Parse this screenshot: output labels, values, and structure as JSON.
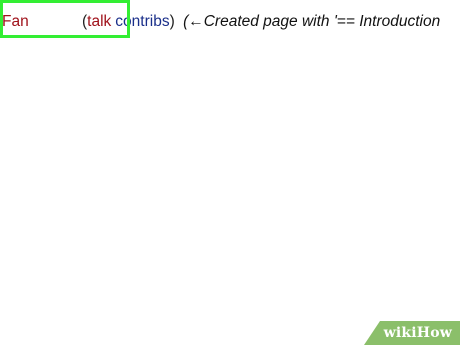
{
  "history_entry": {
    "username": "Fan",
    "open_paren": "(",
    "talk_label": "talk",
    "contribs_label": "contribs",
    "close_paren": ")",
    "summary_open": "(",
    "arrow": "←",
    "summary_text": "Created page with '== Introduction"
  },
  "colors": {
    "link_red": "#a0121b",
    "link_blue": "#1a2f8a",
    "highlight": "#33ee33",
    "watermark_bg": "#8bbf6a"
  },
  "watermark": {
    "text": "wikiHow"
  }
}
